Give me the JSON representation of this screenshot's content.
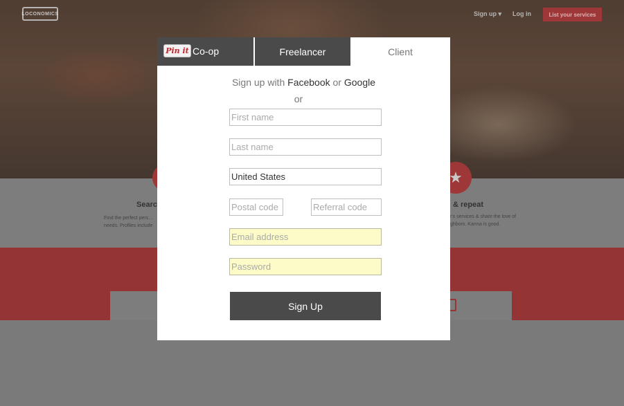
{
  "header": {
    "logo_text": "LOCONOMICS",
    "nav_signup": "Sign up ▾",
    "nav_login": "Log in",
    "nav_list_services": "List your services"
  },
  "features": {
    "left_title": "Searc",
    "left_text": "Find the perfect pers… needs. Profiles include",
    "right_title": "& repeat",
    "right_text": "r's services & share the love of ghbors. Karma is good."
  },
  "modal": {
    "tabs": {
      "pinit": "Pin it",
      "coop": "Co-op",
      "freelancer": "Freelancer",
      "client": "Client"
    },
    "social": {
      "prefix": "Sign up with",
      "facebook": "Facebook",
      "or_word": "or",
      "google": "Google"
    },
    "or_line": "or",
    "fields": {
      "first_name_placeholder": "First name",
      "last_name_placeholder": "Last name",
      "country_value": "United States",
      "postal_placeholder": "Postal code",
      "referral_placeholder": "Referral code",
      "email_placeholder": "Email address",
      "password_placeholder": "Password"
    },
    "signup_button": "Sign Up"
  },
  "colors": {
    "accent_red": "#9e3838",
    "tab_dark": "#4a4a4a",
    "autofill_yellow": "#fdfcc8"
  }
}
